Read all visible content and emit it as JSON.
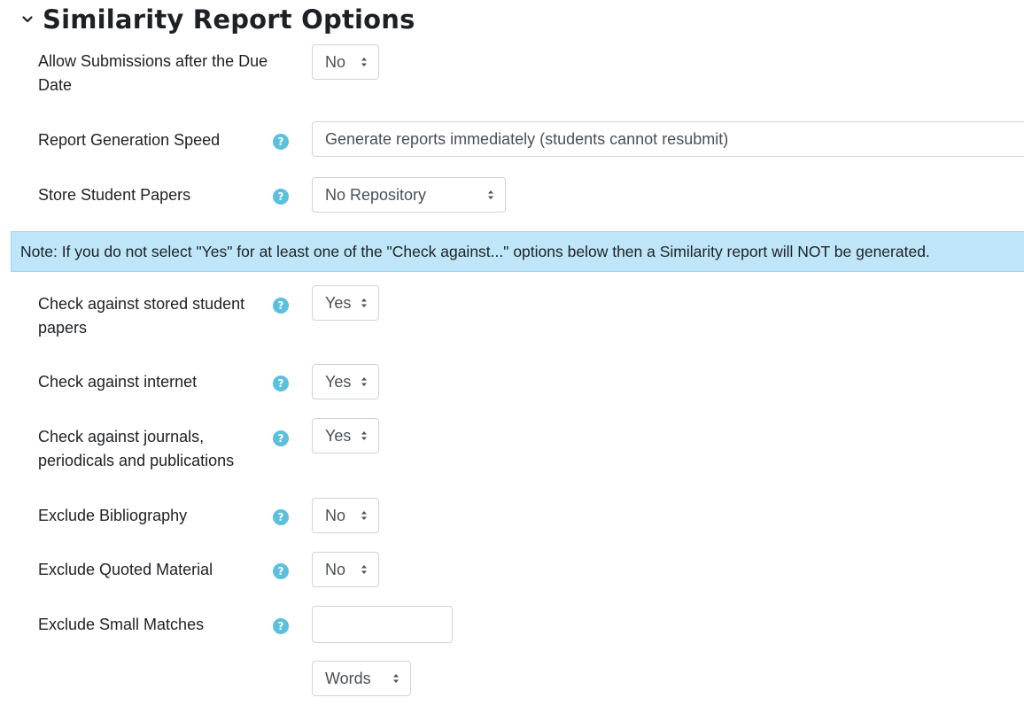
{
  "section": {
    "title": "Similarity Report Options"
  },
  "fields": {
    "allow_late": {
      "label": "Allow Submissions after the Due Date",
      "value": "No"
    },
    "report_speed": {
      "label": "Report Generation Speed",
      "value": "Generate reports immediately (students cannot resubmit)"
    },
    "store_papers": {
      "label": "Store Student Papers",
      "value": "No Repository"
    },
    "check_stored": {
      "label": "Check against stored student papers",
      "value": "Yes"
    },
    "check_internet": {
      "label": "Check against internet",
      "value": "Yes"
    },
    "check_journals": {
      "label": "Check against journals, periodicals and publications",
      "value": "Yes"
    },
    "exclude_biblio": {
      "label": "Exclude Bibliography",
      "value": "No"
    },
    "exclude_quoted": {
      "label": "Exclude Quoted Material",
      "value": "No"
    },
    "exclude_small": {
      "label": "Exclude Small Matches",
      "value": "",
      "unit": "Words"
    }
  },
  "note": "Note: If you do not select \"Yes\" for at least one of the \"Check against...\" options below then a Similarity report will NOT be generated.",
  "icons": {
    "help": "?",
    "help_color": "#5bc0de"
  }
}
